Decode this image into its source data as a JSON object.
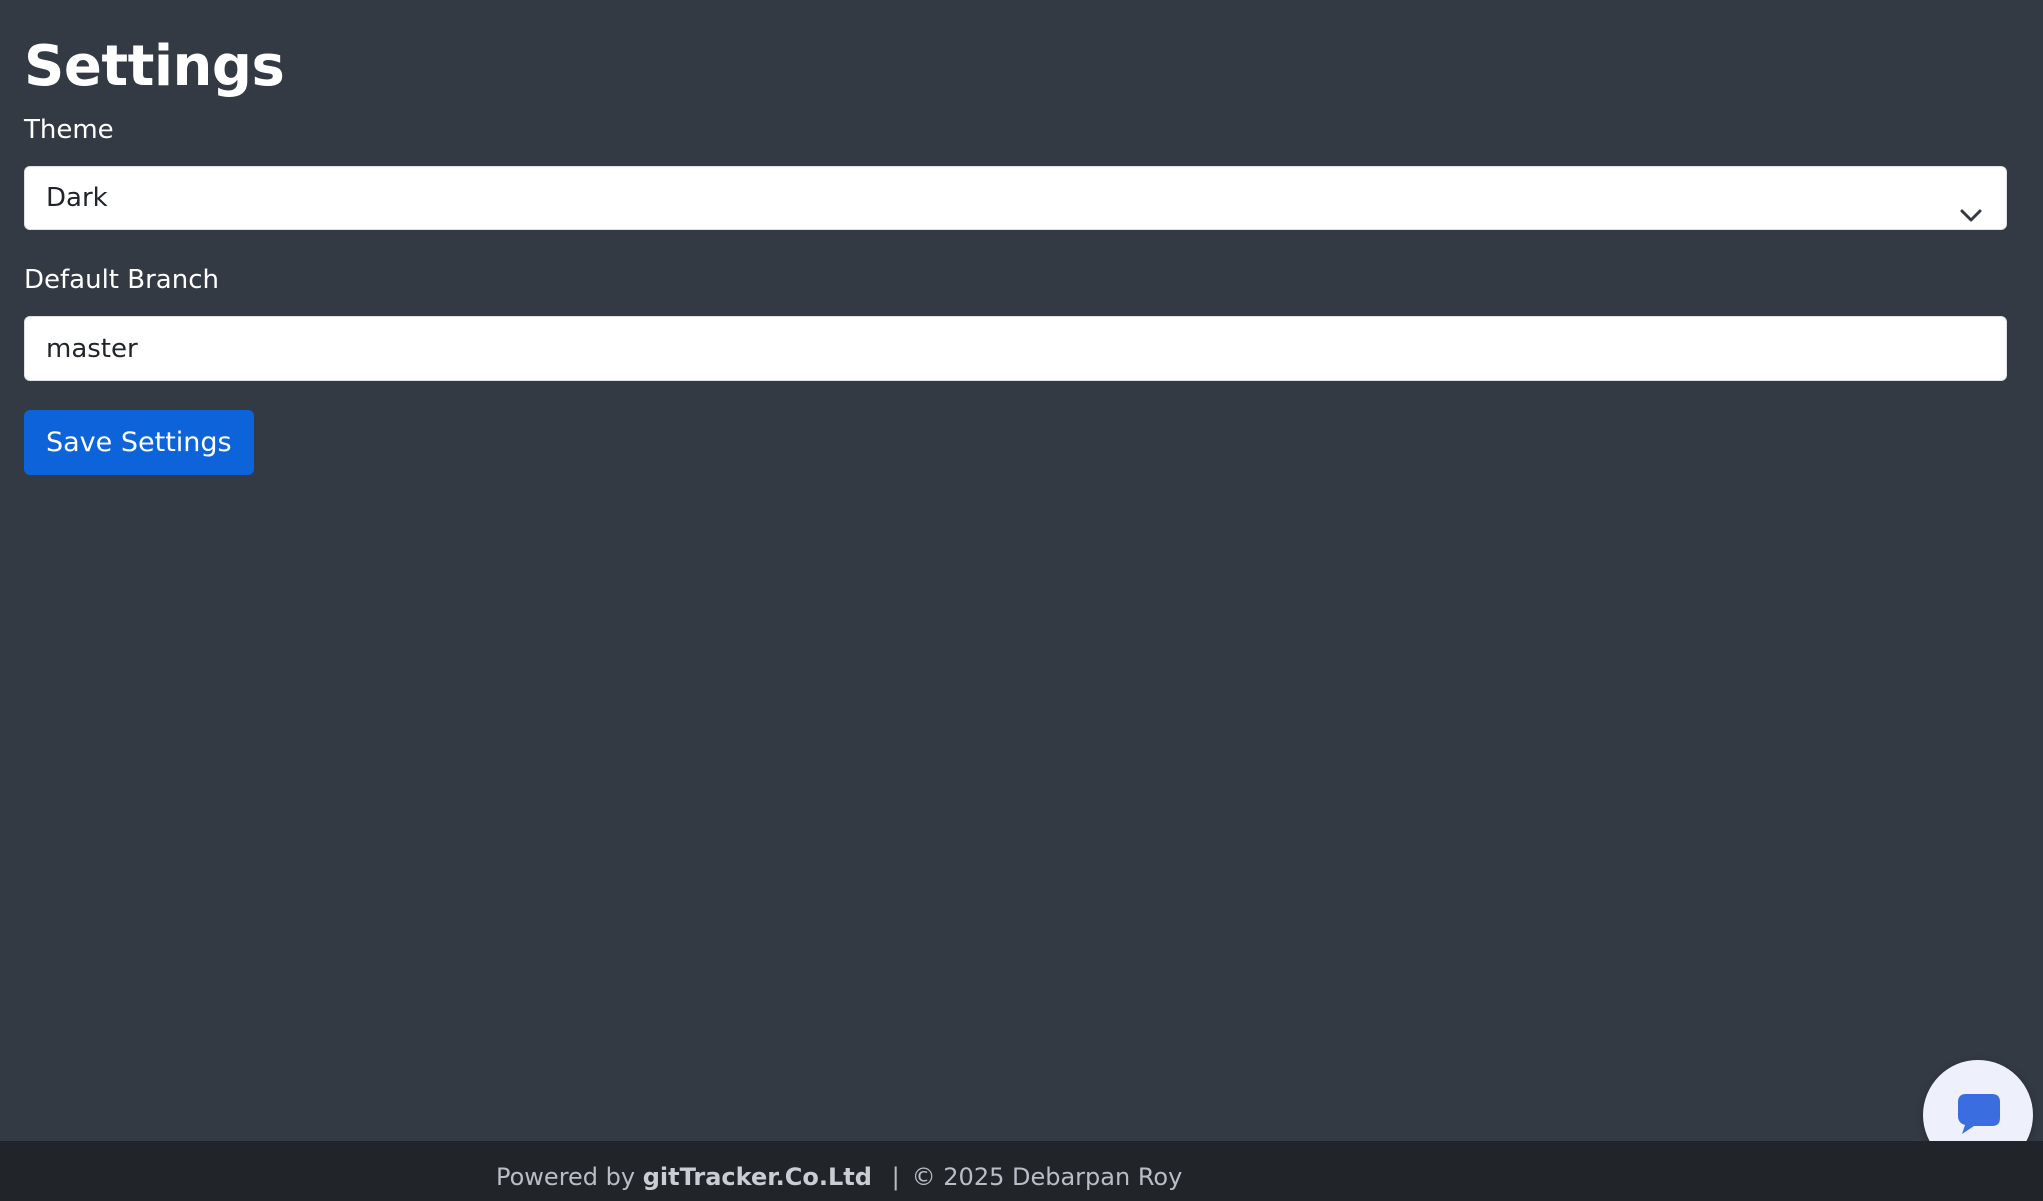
{
  "page": {
    "title": "Settings"
  },
  "form": {
    "theme_label": "Theme",
    "theme_value": "Dark",
    "branch_label": "Default Branch",
    "branch_value": "master",
    "save_label": "Save Settings"
  },
  "footer": {
    "powered_prefix": "Powered by",
    "brand": "gitTracker.Co.Ltd",
    "separator": "|",
    "copyright": "© 2025 Debarpan Roy"
  },
  "icons": {
    "select_caret": "chevron-down-icon",
    "chat": "chat-bubble-icon"
  },
  "colors": {
    "background": "#343a44",
    "footer_background": "#212429",
    "primary_button": "#0d63d9",
    "chat_icon": "#3a6ee0"
  }
}
